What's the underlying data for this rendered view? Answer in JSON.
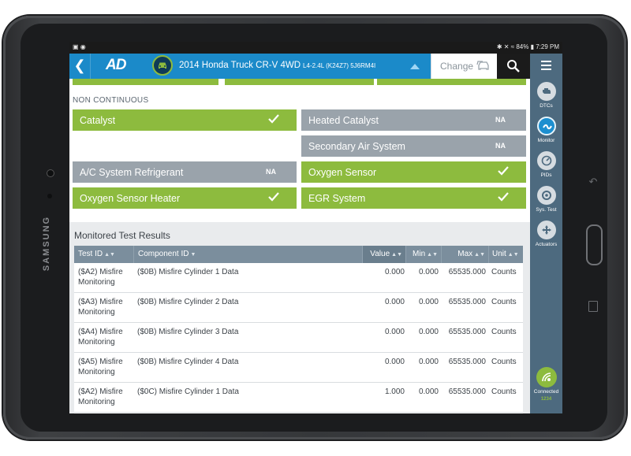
{
  "device": {
    "brand": "SAMSUNG"
  },
  "status_bar": {
    "battery": "84%",
    "time": "7:29 PM"
  },
  "app_bar": {
    "logo": "AD",
    "vehicle": "2014 Honda Truck CR-V 4WD",
    "vehicle_sub": "L4-2.4L (K24Z7) 5J6RM4I",
    "change_label": "Change"
  },
  "rail": {
    "items": [
      {
        "label": "DTCs",
        "icon": "engine-icon"
      },
      {
        "label": "Monitor",
        "icon": "wave-icon",
        "active": true
      },
      {
        "label": "PIDs",
        "icon": "gauge-icon"
      },
      {
        "label": "Sys. Test",
        "icon": "test-icon"
      },
      {
        "label": "Actuators",
        "icon": "move-icon"
      }
    ],
    "connected_label": "Connected",
    "connected_sub": "1234"
  },
  "colors": {
    "accent": "#1b8ac9",
    "pass": "#8dbb3e",
    "na": "#9aa3ab",
    "rail": "#4d6a7f",
    "header": "#7b8e9d"
  },
  "monitors": {
    "section_label": "NON CONTINUOUS",
    "na_text": "NA",
    "tiles": [
      {
        "name": "Catalyst",
        "status": "pass"
      },
      {
        "name": "Heated Catalyst",
        "status": "na"
      },
      {
        "name": "Secondary Air System",
        "status": "na"
      },
      {
        "name": "A/C System Refrigerant",
        "status": "na"
      },
      {
        "name": "Oxygen Sensor",
        "status": "pass"
      },
      {
        "name": "Oxygen Sensor Heater",
        "status": "pass"
      },
      {
        "name": "EGR System",
        "status": "pass"
      }
    ]
  },
  "results": {
    "title": "Monitored Test Results",
    "columns": [
      "Test ID",
      "Component ID",
      "Value",
      "Min",
      "Max",
      "Unit"
    ],
    "rows": [
      {
        "test": "($A2) Misfire Monitoring",
        "component": "($0B) Misfire Cylinder 1 Data",
        "value": "0.000",
        "min": "0.000",
        "max": "65535.000",
        "unit": "Counts"
      },
      {
        "test": "($A3) Misfire Monitoring",
        "component": "($0B) Misfire Cylinder 2 Data",
        "value": "0.000",
        "min": "0.000",
        "max": "65535.000",
        "unit": "Counts"
      },
      {
        "test": "($A4) Misfire Monitoring",
        "component": "($0B) Misfire Cylinder 3 Data",
        "value": "0.000",
        "min": "0.000",
        "max": "65535.000",
        "unit": "Counts"
      },
      {
        "test": "($A5) Misfire Monitoring",
        "component": "($0B) Misfire Cylinder 4 Data",
        "value": "0.000",
        "min": "0.000",
        "max": "65535.000",
        "unit": "Counts"
      },
      {
        "test": "($A2) Misfire Monitoring",
        "component": "($0C) Misfire Cylinder 1 Data",
        "value": "1.000",
        "min": "0.000",
        "max": "65535.000",
        "unit": "Counts"
      }
    ]
  }
}
